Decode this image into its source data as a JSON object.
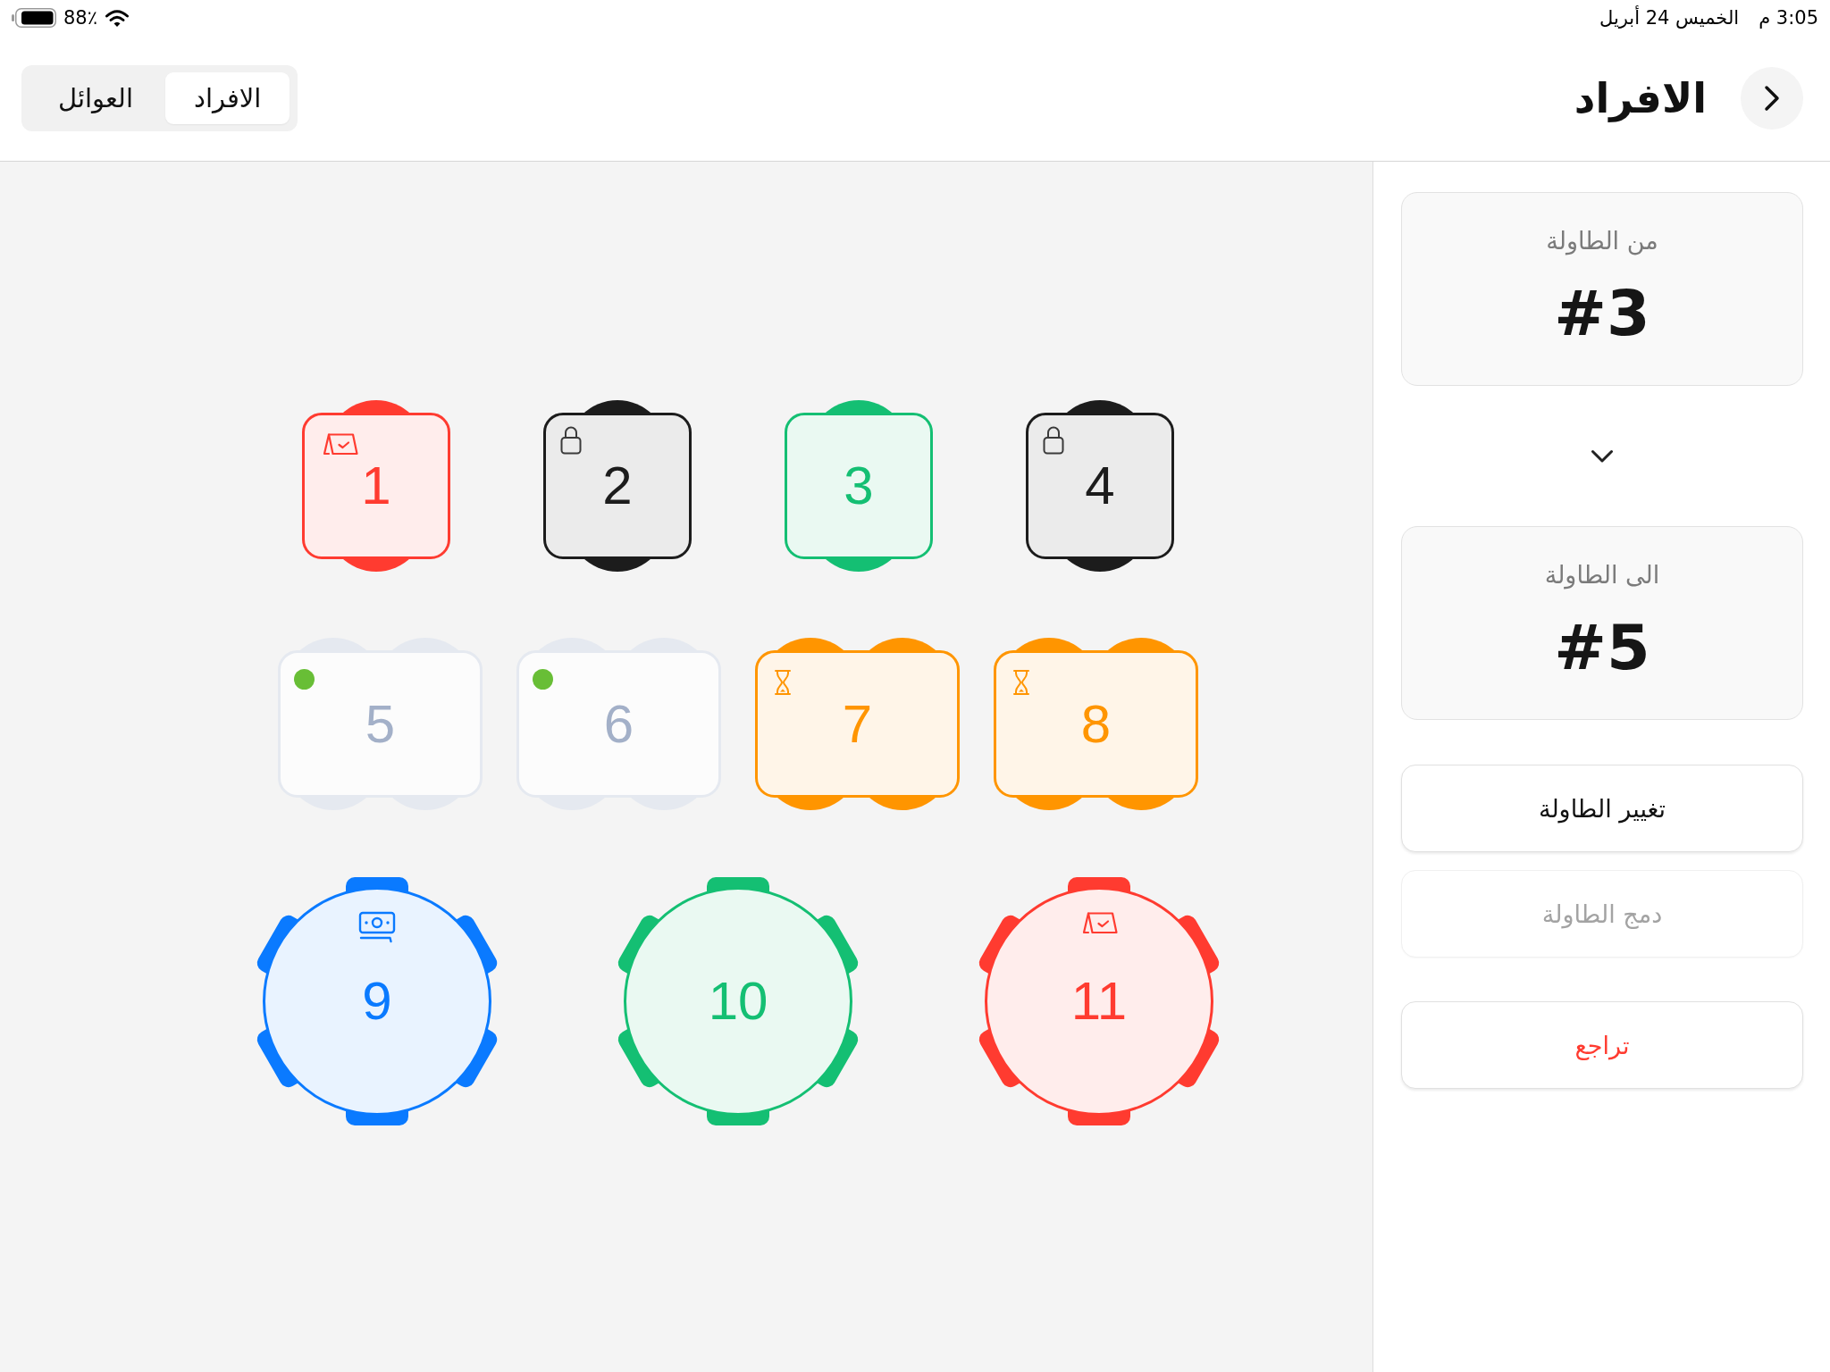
{
  "status_bar": {
    "time": "3:05 م",
    "date": "الخميس 24 أبريل",
    "battery": "88٪"
  },
  "header": {
    "title": "الافراد",
    "segments": [
      {
        "label": "الافراد",
        "selected": true
      },
      {
        "label": "العوائل",
        "selected": false
      }
    ]
  },
  "floor": {
    "rows": [
      {
        "kind": "square",
        "tables": [
          {
            "number": "4",
            "kind": "locked",
            "color": "#1c1c1c"
          },
          {
            "number": "3",
            "kind": "active",
            "color": "#14bf73"
          },
          {
            "number": "2",
            "kind": "locked",
            "color": "#1c1c1c"
          },
          {
            "number": "1",
            "kind": "billed",
            "color": "#ff3b30"
          }
        ]
      },
      {
        "kind": "rect",
        "tables": [
          {
            "number": "8",
            "kind": "waiting",
            "color": "#ff9500"
          },
          {
            "number": "7",
            "kind": "waiting",
            "color": "#ff9500"
          },
          {
            "number": "6",
            "kind": "free",
            "color": "#a3b0c8"
          },
          {
            "number": "5",
            "kind": "free",
            "color": "#a3b0c8"
          }
        ]
      },
      {
        "kind": "round",
        "tables": [
          {
            "number": "11",
            "kind": "billed",
            "color": "#ff3b30"
          },
          {
            "number": "10",
            "kind": "active",
            "color": "#14bf73"
          },
          {
            "number": "9",
            "kind": "paying",
            "color": "#0a7aff"
          }
        ]
      }
    ]
  },
  "transfer": {
    "cards": [
      {
        "label": "من الطاولة",
        "value": "#3"
      },
      {
        "label": "الى الطاولة",
        "value": "#5"
      }
    ],
    "buttons": [
      {
        "label": "تغيير الطاولة",
        "kind": "normal",
        "disabled": false
      },
      {
        "label": "دمج الطاولة",
        "kind": "normal",
        "disabled": true
      },
      {
        "label": "تراجع",
        "kind": "destructive",
        "disabled": false
      }
    ]
  }
}
